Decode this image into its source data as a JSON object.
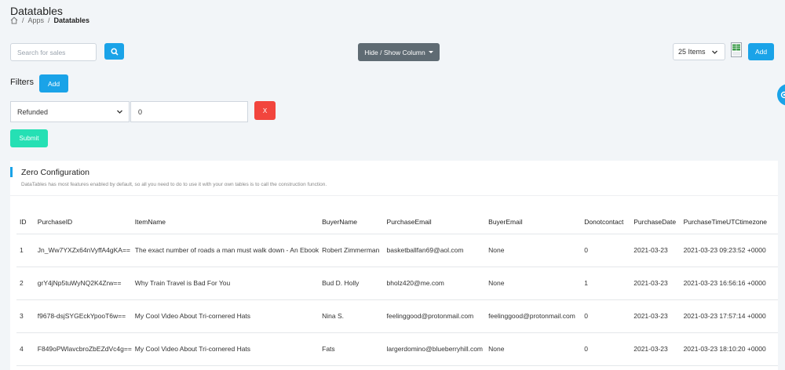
{
  "page": {
    "title": "Datatables",
    "breadcrumb": [
      "Apps",
      "/",
      "Datatables"
    ]
  },
  "toolbar": {
    "search_placeholder": "Search for sales",
    "hide_show_label": "Hide / Show Column",
    "items_per_page": "25 Items",
    "add_label": "Add"
  },
  "filters": {
    "label": "Filters",
    "add_label": "Add",
    "selected_field": "Refunded",
    "value": "0",
    "remove_label": "X",
    "submit_label": "Submit"
  },
  "card": {
    "title": "Zero Configuration",
    "description": "DataTables has most features enabled by default, so all you need to do to use it with your own tables is to call the construction function."
  },
  "table": {
    "columns": [
      "ID",
      "PurchaseID",
      "ItemName",
      "BuyerName",
      "PurchaseEmail",
      "BuyerEmail",
      "Donotcontact",
      "PurchaseDate",
      "PurchaseTimeUTCtimezone"
    ],
    "rows": [
      [
        "1",
        "Jn_Ww7YXZx64nVyffA4gKA==",
        "The exact number of roads a man must walk down - An Ebook",
        "Robert Zimmerman",
        "basketballfan69@aol.com",
        "None",
        "0",
        "2021-03-23",
        "2021-03-23 09:23:52 +0000"
      ],
      [
        "2",
        "grY4jNp5tuWyNQ2K4Zrw==",
        "Why Train Travel is Bad For You",
        "Bud D. Holly",
        "bholz420@me.com",
        "None",
        "1",
        "2021-03-23",
        "2021-03-23 16:56:16 +0000"
      ],
      [
        "3",
        "f9678-dsjSYGEckYpooT6w==",
        "My Cool Video About Tri-cornered Hats",
        "Nina S.",
        "feelinggood@protonmail.com",
        "feelinggood@protonmail.com",
        "0",
        "2021-03-23",
        "2021-03-23 17:57:14 +0000"
      ],
      [
        "4",
        "F849oPWlavcbroZbEZdVc4g==",
        "My Cool Video About Tri-cornered Hats",
        "Fats",
        "largerdomino@blueberryhill.com",
        "None",
        "0",
        "2021-03-23",
        "2021-03-23 18:10:20 +0000"
      ]
    ]
  },
  "icons": {
    "home": "home-icon",
    "search": "search-icon",
    "csv": "csv-file-icon",
    "settings": "gear-icon"
  },
  "colors": {
    "primary": "#1aa3e8",
    "danger": "#f2453d",
    "success": "#25e0b4",
    "secondary": "#5f6b73"
  }
}
